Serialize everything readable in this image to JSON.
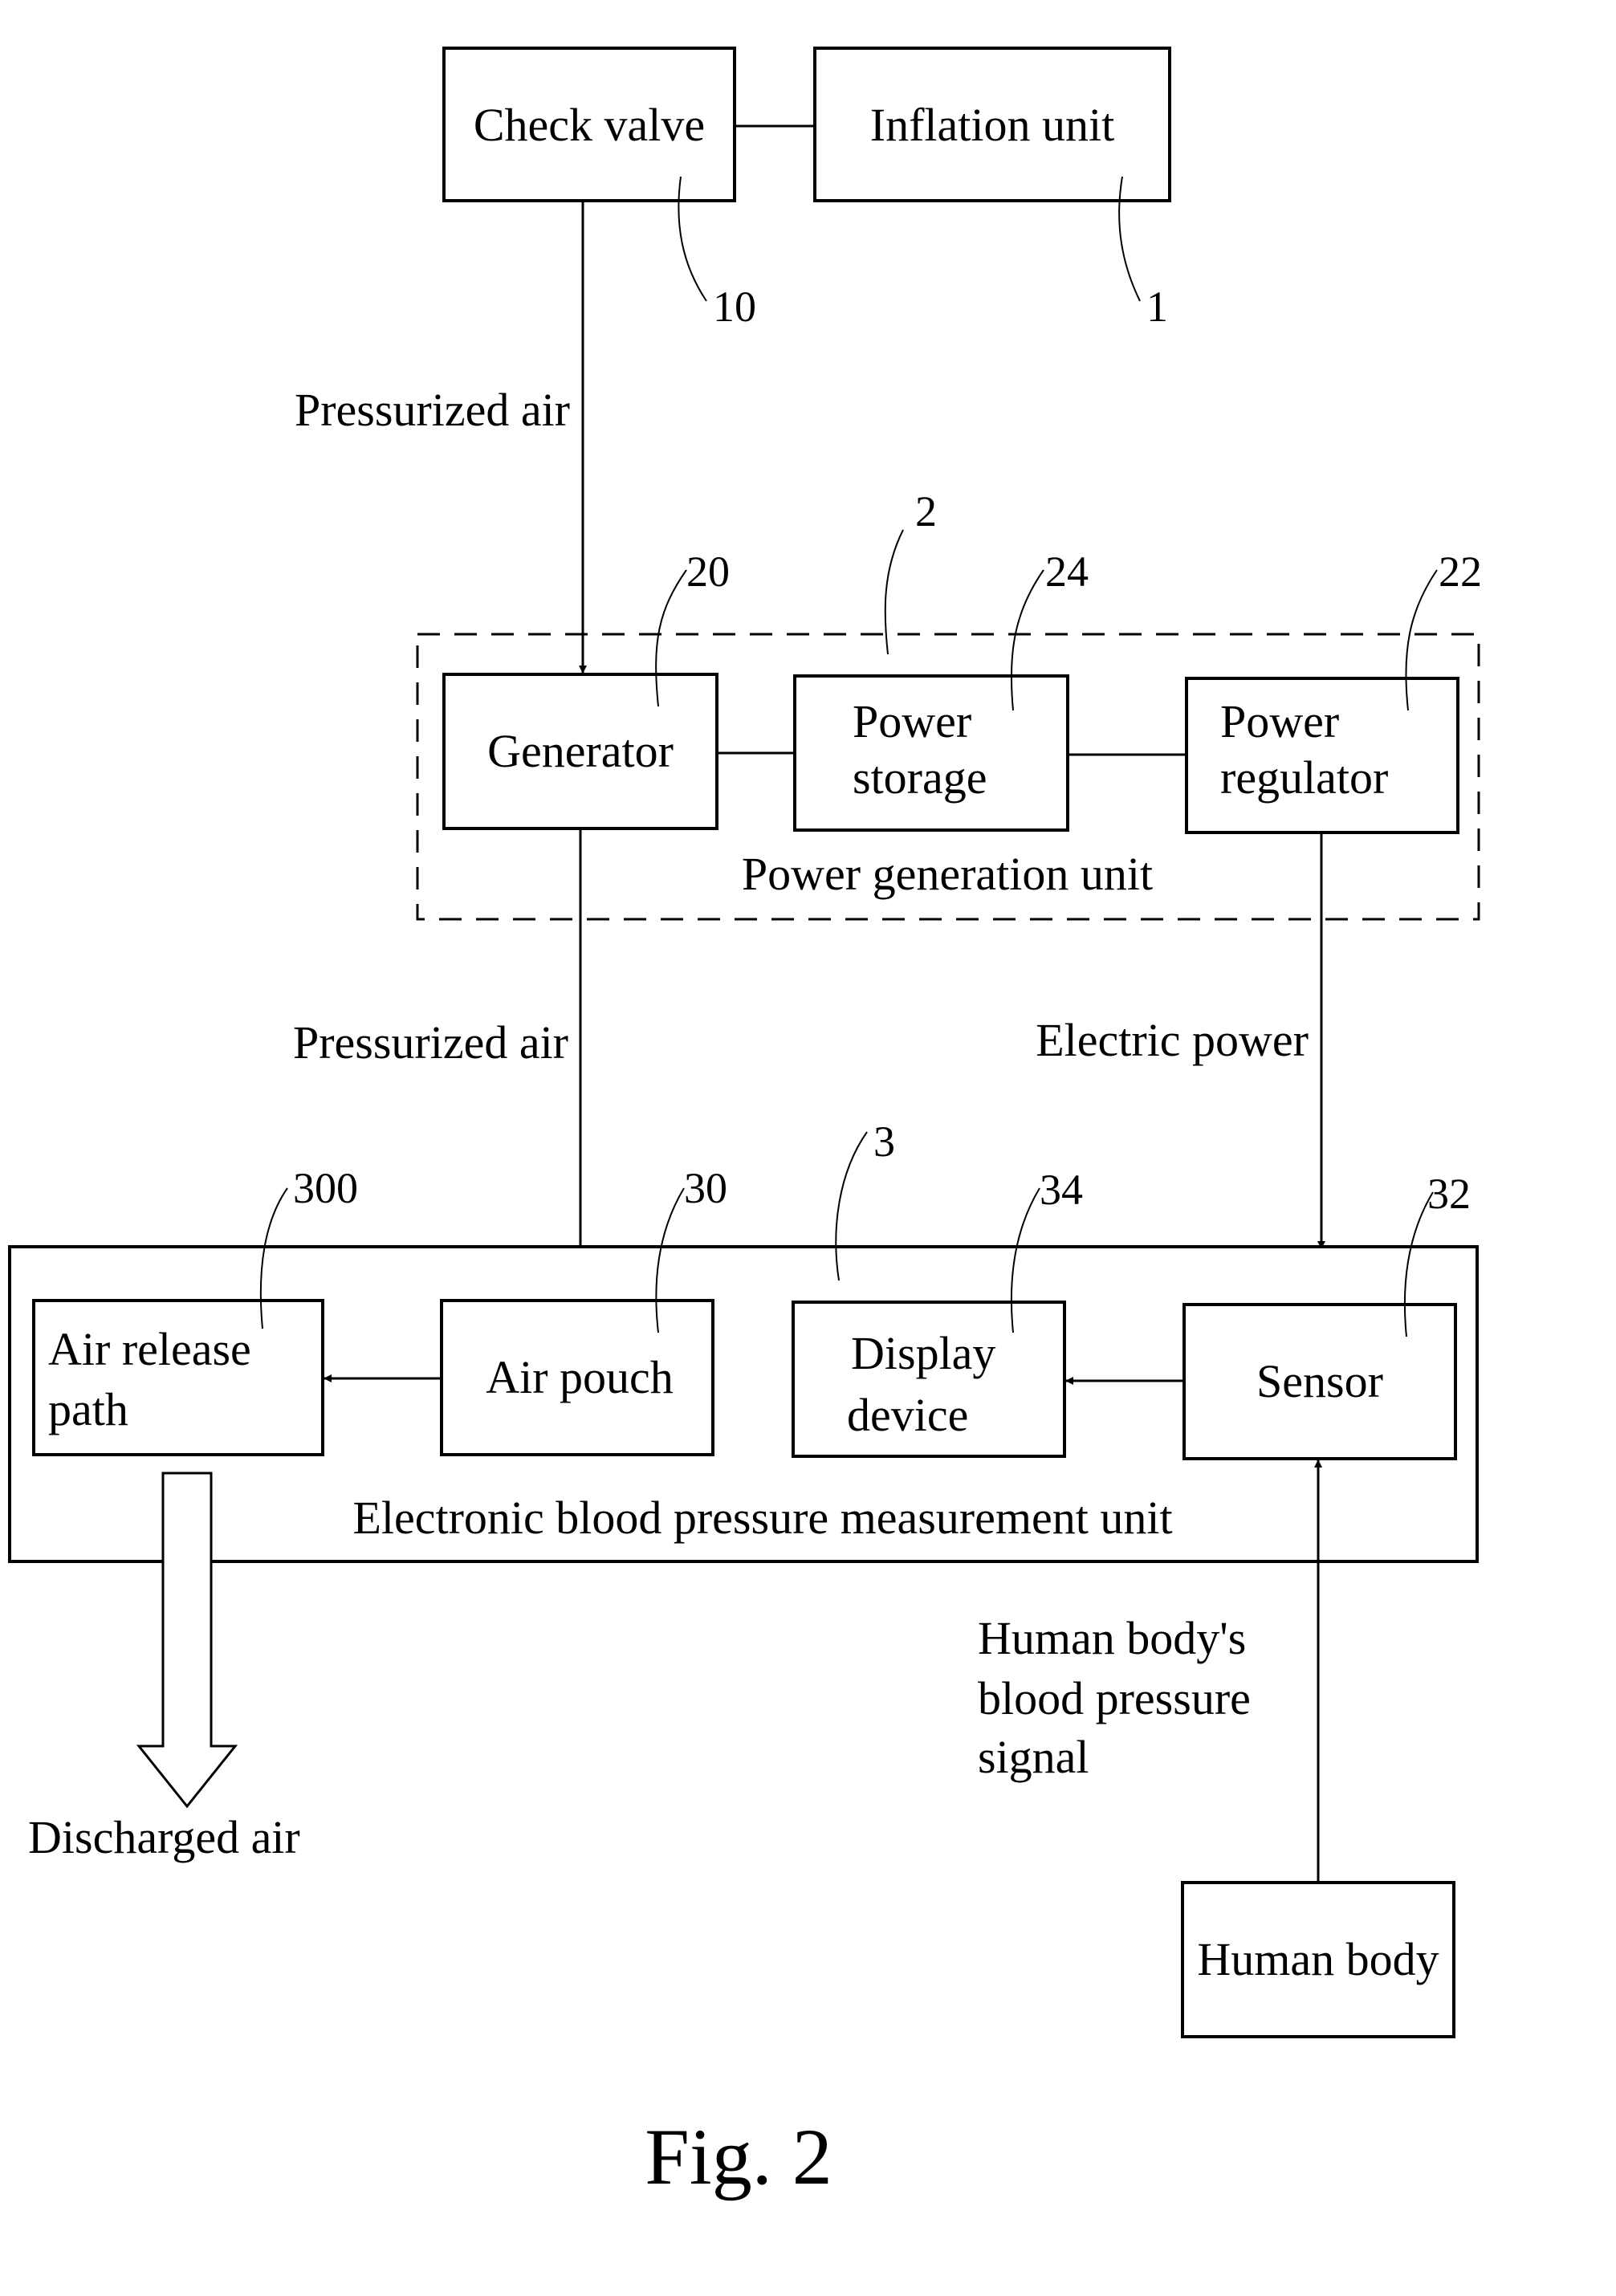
{
  "figure": {
    "caption": "Fig. 2"
  },
  "blocks": {
    "check_valve": {
      "label": "Check valve",
      "ref": "10"
    },
    "inflation_unit": {
      "label": "Inflation unit",
      "ref": "1"
    },
    "power_generation_unit": {
      "label": "Power generation unit",
      "ref": "2"
    },
    "generator": {
      "label": "Generator",
      "ref": "20"
    },
    "power_storage": {
      "line1": "Power",
      "line2": "storage",
      "ref": "24"
    },
    "power_regulator": {
      "line1": "Power",
      "line2": "regulator",
      "ref": "22"
    },
    "measurement_unit": {
      "label": "Electronic blood pressure measurement unit",
      "ref": "3"
    },
    "air_release_path": {
      "line1": "Air release",
      "line2": "path",
      "ref": "300"
    },
    "air_pouch": {
      "label": "Air pouch",
      "ref": "30"
    },
    "display_device": {
      "line1": "Display",
      "line2": "device",
      "ref": "34"
    },
    "sensor": {
      "label": "Sensor",
      "ref": "32"
    },
    "human_body": {
      "label": "Human body"
    }
  },
  "flows": {
    "pressurized_air_1": "Pressurized air",
    "pressurized_air_2": "Pressurized air",
    "electric_power": "Electric power",
    "discharged_air": "Discharged air",
    "bp_signal": {
      "line1": "Human body's",
      "line2": "blood pressure",
      "line3": "signal"
    }
  }
}
